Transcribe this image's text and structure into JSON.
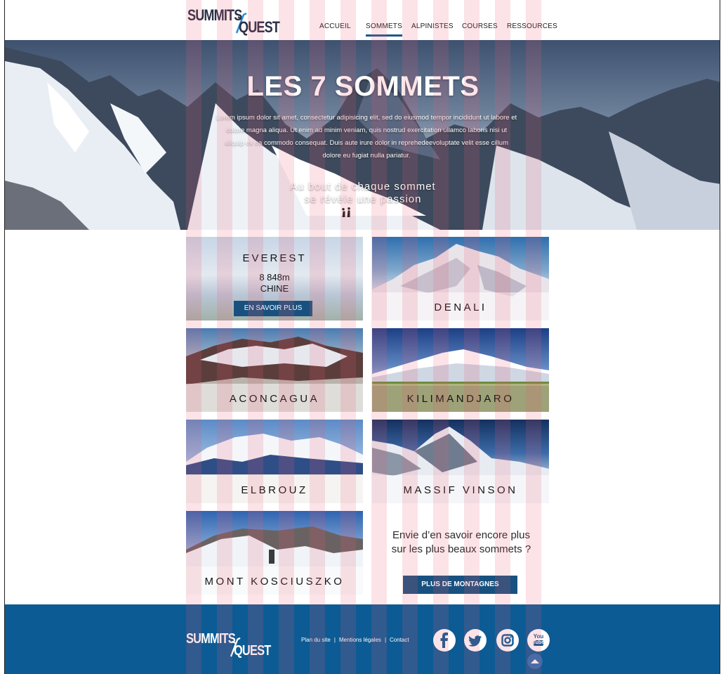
{
  "brand": {
    "word1": "SUMMITS",
    "word2": "QUEST"
  },
  "nav": [
    {
      "label": "ACCUEIL"
    },
    {
      "label": "SOMMETS",
      "active": true
    },
    {
      "label": "ALPINISTES"
    },
    {
      "label": "COURSES"
    },
    {
      "label": "RESSOURCES"
    }
  ],
  "hero": {
    "title": "LES 7 SOMMETS",
    "text": "Lorem ipsum dolor sit amet, consectetur adipisicing elit, sed do eiusmod tempor incididunt ut labore et dolore magna aliqua. Ut enim ad minim veniam, quis nostrud exercitation ullamco laboris nisi ut aliquip ex ea commodo consequat. Duis aute irure dolor in reprehedeevoluptate velit esse cillum dolore eu fugiat nulla pariatur.",
    "slogan_line1": "Au bout de chaque sommet",
    "slogan_line2": "se révèle une passion"
  },
  "everest": {
    "name": "EVEREST",
    "altitude": "8 848m",
    "country": "CHINE",
    "button": "EN SAVOIR PLUS"
  },
  "summits": [
    {
      "name": "DENALI"
    },
    {
      "name": "ACONCAGUA"
    },
    {
      "name": "KILIMANDJARO"
    },
    {
      "name": "ELBROUZ"
    },
    {
      "name": "MASSIF VINSON"
    },
    {
      "name": "MONT KOSCIUSZKO"
    }
  ],
  "promo": {
    "line1": "Envie d’en savoir encore plus",
    "line2": "sur les plus beaux sommets ?",
    "button": "PLUS DE MONTAGNES"
  },
  "footer": {
    "links": [
      "Plan du site",
      "Mentions légales",
      "Contact"
    ],
    "separator": "|",
    "social": [
      "facebook-icon",
      "twitter-icon",
      "instagram-icon",
      "youtube-icon"
    ],
    "youtube_line1": "You",
    "youtube_line2": "Tube"
  },
  "colors": {
    "brand_blue": "#18517f",
    "footer_blue": "#0c5b94",
    "logo_dark": "#2a2f45",
    "grid_overlay": "#eb5a6e"
  }
}
